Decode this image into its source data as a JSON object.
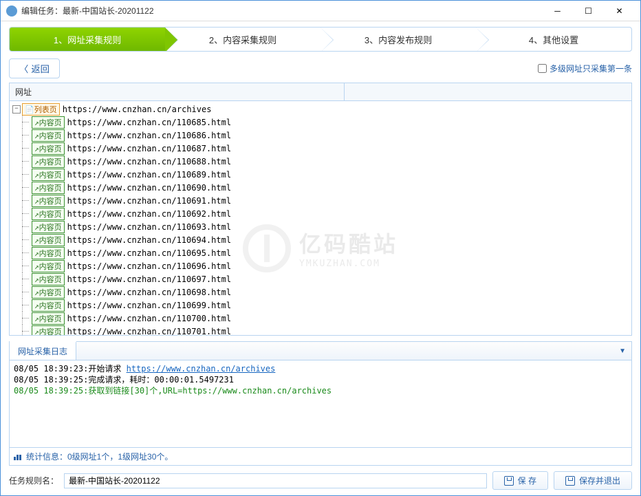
{
  "window": {
    "title": "编辑任务：最新-中国站长-20201122"
  },
  "tabs": [
    {
      "label": "1、网址采集规则"
    },
    {
      "label": "2、内容采集规则"
    },
    {
      "label": "3、内容发布规则"
    },
    {
      "label": "4、其他设置"
    }
  ],
  "back_label": "返回",
  "multilevel_checkbox": "多级网址只采集第一条",
  "grid_header": "网址",
  "root_tag": "列表页",
  "root_url": "https://www.cnzhan.cn/archives",
  "child_tag": "内容页",
  "children": [
    "https://www.cnzhan.cn/110685.html",
    "https://www.cnzhan.cn/110686.html",
    "https://www.cnzhan.cn/110687.html",
    "https://www.cnzhan.cn/110688.html",
    "https://www.cnzhan.cn/110689.html",
    "https://www.cnzhan.cn/110690.html",
    "https://www.cnzhan.cn/110691.html",
    "https://www.cnzhan.cn/110692.html",
    "https://www.cnzhan.cn/110693.html",
    "https://www.cnzhan.cn/110694.html",
    "https://www.cnzhan.cn/110695.html",
    "https://www.cnzhan.cn/110696.html",
    "https://www.cnzhan.cn/110697.html",
    "https://www.cnzhan.cn/110698.html",
    "https://www.cnzhan.cn/110699.html",
    "https://www.cnzhan.cn/110700.html",
    "https://www.cnzhan.cn/110701.html"
  ],
  "watermark": {
    "cn": "亿码酷站",
    "en": "YMKUZHAN.COM"
  },
  "log": {
    "tab": "网址采集日志",
    "lines": [
      {
        "ts": "08/05 18:39:23:",
        "text": "开始请求 ",
        "link": "https://www.cnzhan.cn/archives",
        "cls": ""
      },
      {
        "ts": "08/05 18:39:25:",
        "text": "完成请求，耗时：00:00:01.5497231",
        "link": "",
        "cls": ""
      },
      {
        "ts": "08/05 18:39:25:",
        "text": "获取到链接[30]个,URL=https://www.cnzhan.cn/archives",
        "link": "",
        "cls": "green"
      }
    ],
    "stats": "统计信息：0级网址1个，1级网址30个。"
  },
  "bottom": {
    "label": "任务规则名：",
    "value": "最新-中国站长-20201122",
    "save": "保 存",
    "save_exit": "保存并退出"
  }
}
